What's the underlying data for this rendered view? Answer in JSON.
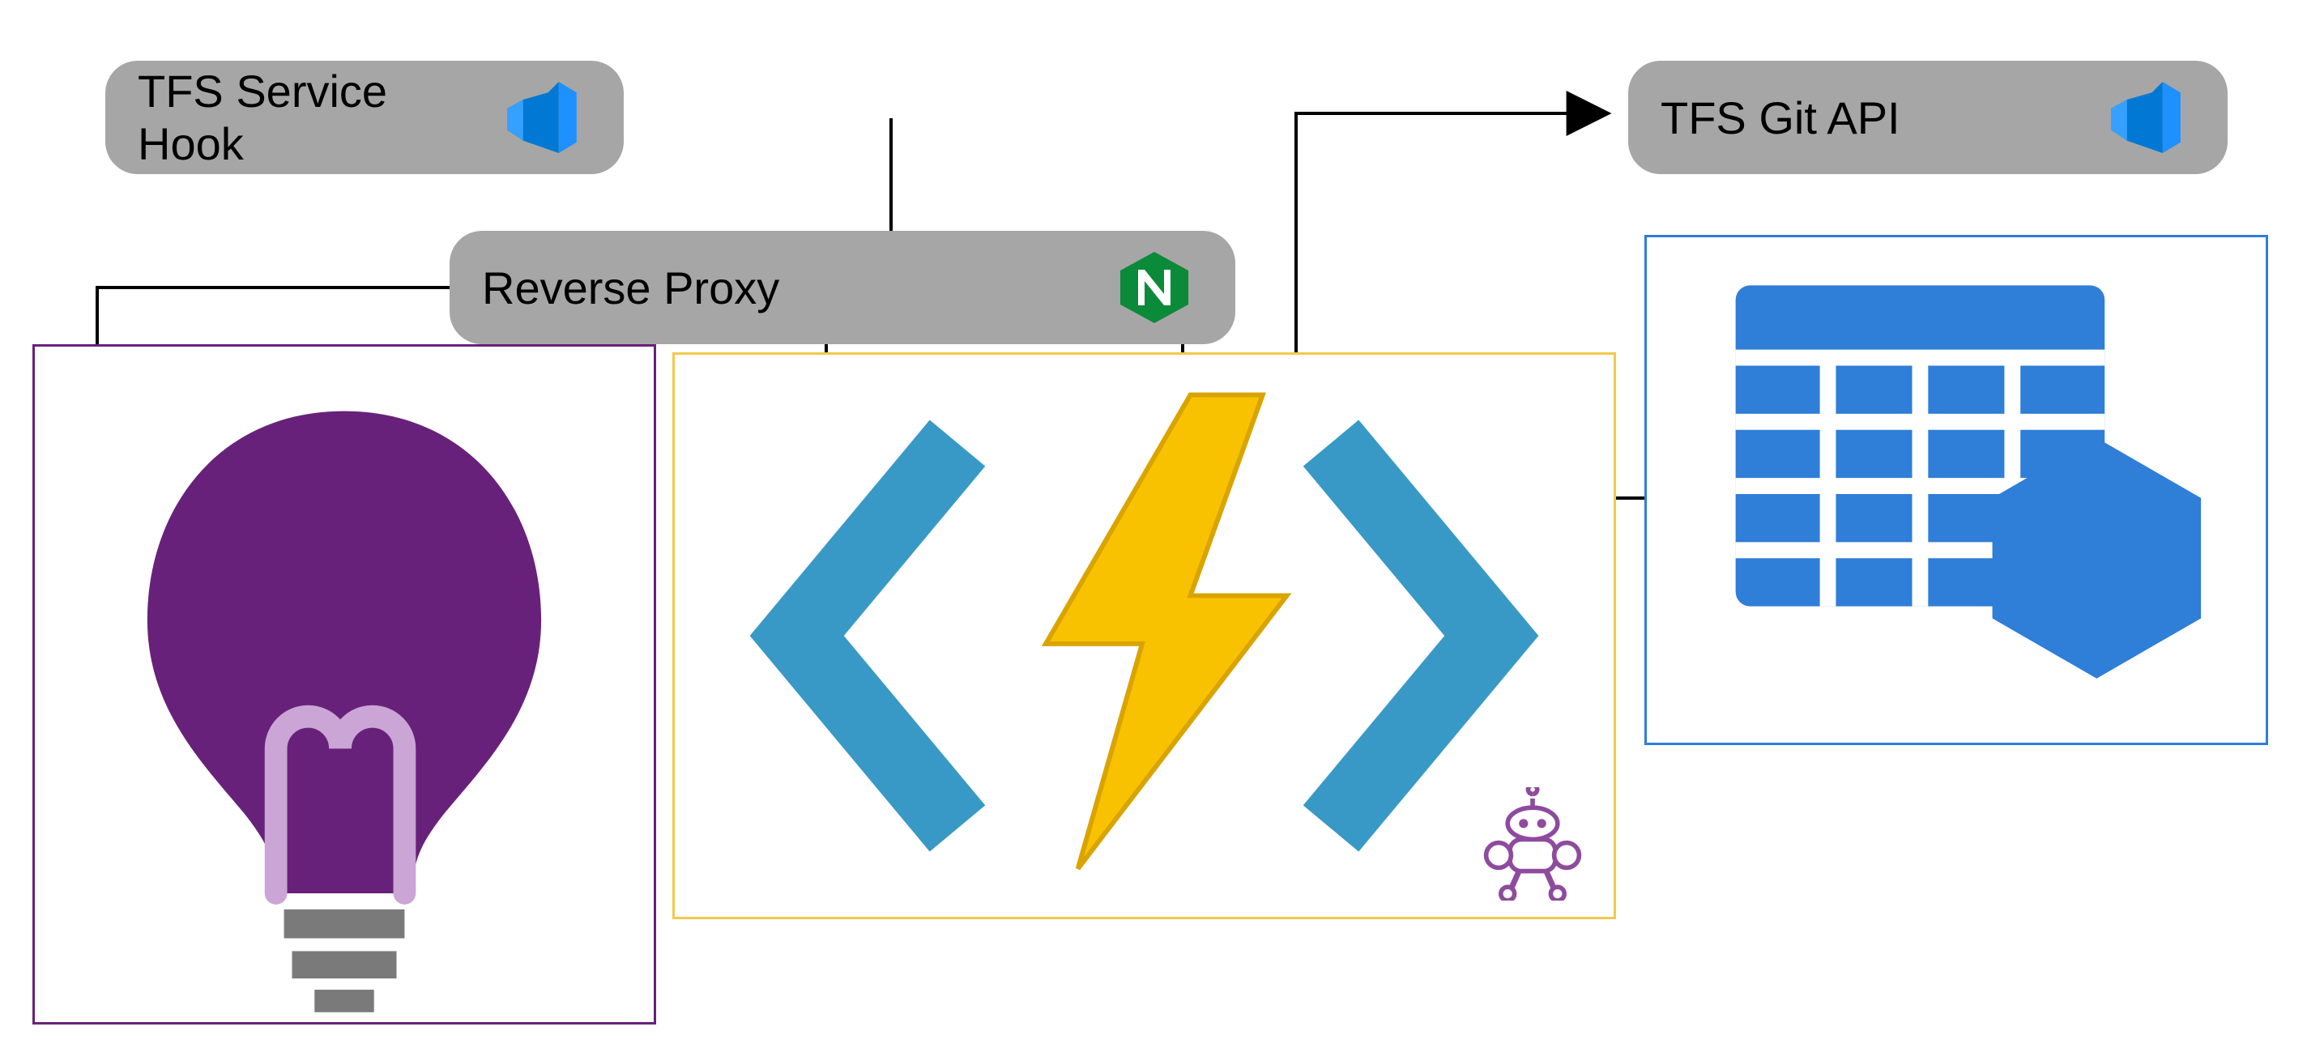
{
  "nodes": {
    "tfs_service_hook": {
      "label": "TFS Service Hook",
      "icon": "vsts-icon"
    },
    "reverse_proxy": {
      "label": "Reverse Proxy",
      "icon": "nginx-icon"
    },
    "tfs_git_api": {
      "label": "TFS Git API",
      "icon": "vsts-icon"
    }
  },
  "panels": {
    "app_insights": {
      "icon": "lightbulb-icon"
    },
    "azure_functions": {
      "icons": [
        "functions-icon",
        "robot-icon"
      ]
    },
    "table_storage": {
      "icon": "table-hexagon-icon"
    }
  },
  "edges": [
    {
      "from": "tfs_service_hook",
      "to": "reverse_proxy"
    },
    {
      "from": "reverse_proxy",
      "to": "app_insights"
    },
    {
      "from": "reverse_proxy",
      "to": "azure_functions"
    },
    {
      "from": "azure_functions",
      "to": "tfs_git_api"
    },
    {
      "from": "azure_functions",
      "to": "table_storage"
    }
  ]
}
